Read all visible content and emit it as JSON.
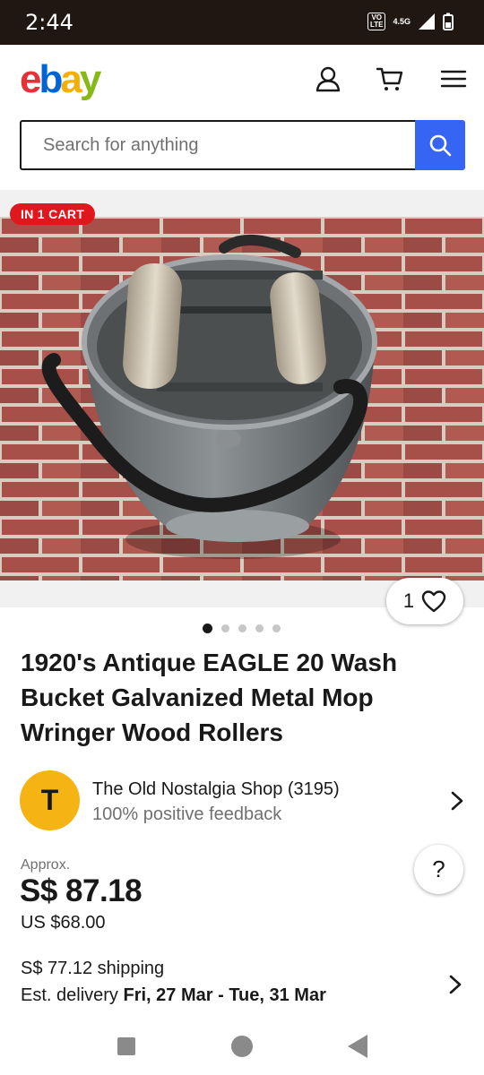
{
  "status_bar": {
    "time": "2:44",
    "volte": "VO\nLTE",
    "network": "4.5G"
  },
  "header": {
    "logo_letters": [
      "e",
      "b",
      "a",
      "y"
    ]
  },
  "search": {
    "placeholder": "Search for anything"
  },
  "listing": {
    "cart_badge": "IN 1 CART",
    "watch_count": "1",
    "image_count": 5,
    "active_image": 1,
    "title": "1920's Antique EAGLE 20 Wash Bucket Galvanized Metal Mop Wringer Wood Rollers"
  },
  "seller": {
    "initial": "T",
    "name": "The Old Nostalgia Shop (3195)",
    "feedback": "100% positive feedback"
  },
  "price": {
    "approx_label": "Approx.",
    "local": "S$ 87.18",
    "usd": "US $68.00"
  },
  "help": {
    "label": "?"
  },
  "shipping": {
    "cost": "S$ 77.12 shipping",
    "delivery_label": "Est. delivery",
    "delivery_dates": "Fri, 27 Mar - Tue, 31 Mar"
  },
  "colors": {
    "accent": "#3665f3",
    "badge": "#e0171d",
    "avatar": "#f5b413"
  }
}
